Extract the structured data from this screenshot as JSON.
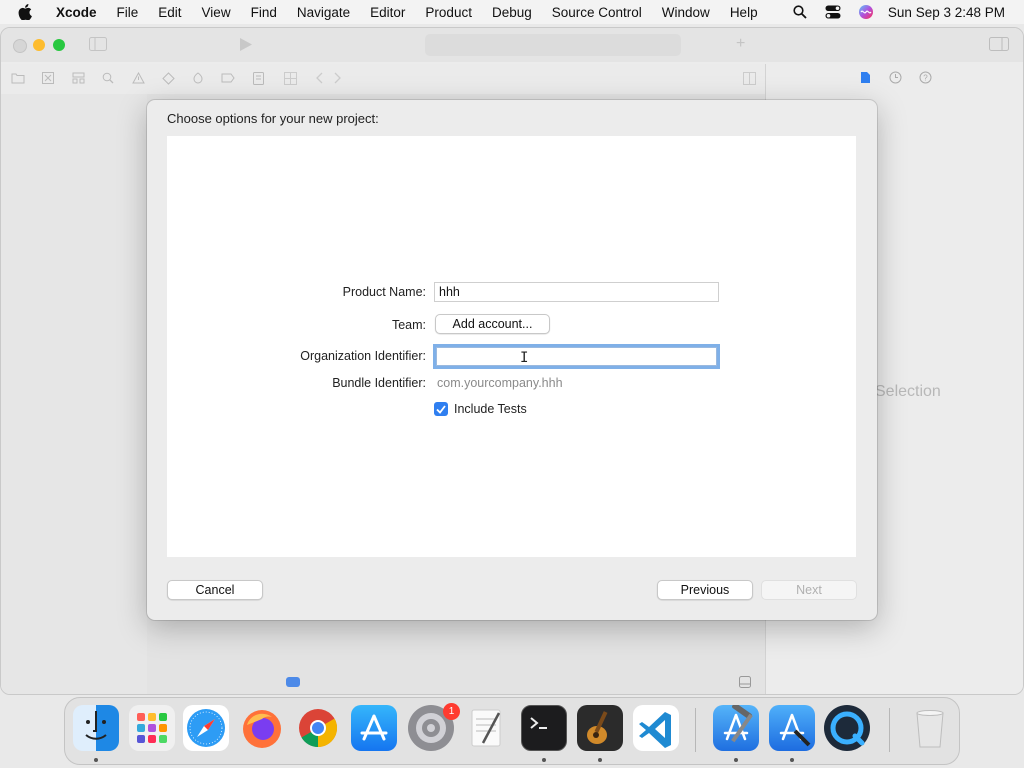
{
  "menubar": {
    "app_name": "Xcode",
    "items": [
      "File",
      "Edit",
      "View",
      "Find",
      "Navigate",
      "Editor",
      "Product",
      "Debug",
      "Source Control",
      "Window",
      "Help"
    ],
    "clock": "Sun Sep 3  2:48 PM"
  },
  "window": {
    "no_selection_text": "Selection"
  },
  "sheet": {
    "title": "Choose options for your new project:",
    "product_name_label": "Product Name:",
    "product_name_value": "hhh",
    "team_label": "Team:",
    "team_button": "Add account...",
    "org_id_label": "Organization Identifier:",
    "org_id_value": "",
    "bundle_id_label": "Bundle Identifier:",
    "bundle_id_value": "com.yourcompany.hhh",
    "include_tests_label": "Include Tests",
    "include_tests_checked": true,
    "cancel_label": "Cancel",
    "previous_label": "Previous",
    "next_label": "Next"
  },
  "dock": {
    "apps": [
      "finder-icon",
      "launchpad-icon",
      "safari-icon",
      "firefox-icon",
      "chrome-icon",
      "app-store-icon",
      "system-settings-icon",
      "textedit-icon",
      "terminal-icon",
      "garageband-icon",
      "vscode-icon",
      "xcode-icon",
      "simulator-icon",
      "quicktime-icon",
      "trash-icon"
    ],
    "settings_badge": "1"
  },
  "colors": {
    "accent": "#2f7ff0",
    "focus_ring": "#7fb0e8"
  }
}
